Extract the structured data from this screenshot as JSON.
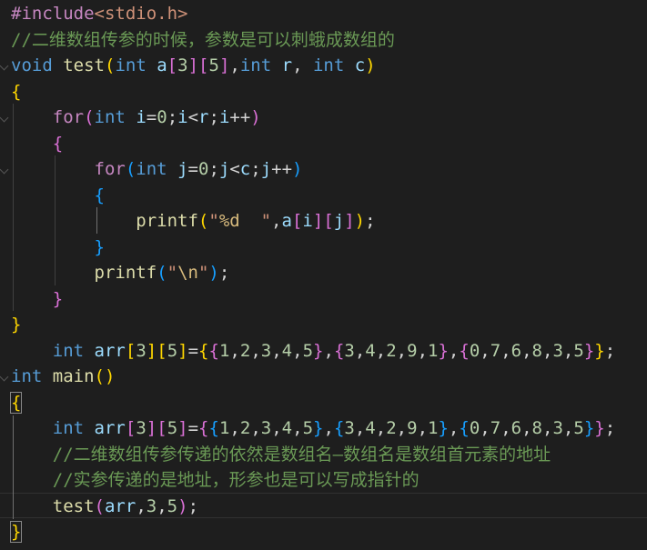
{
  "editor": {
    "lines": [
      [
        {
          "t": "#include",
          "c": "pp"
        },
        {
          "t": "<stdio.h>",
          "c": "inc"
        }
      ],
      [
        {
          "t": "//二维数组传参的时候，参数是可以刺蛾成数组的",
          "c": "cm"
        }
      ],
      [
        {
          "t": "void",
          "c": "kw"
        },
        {
          "t": " ",
          "c": "p"
        },
        {
          "t": "test",
          "c": "fn"
        },
        {
          "t": "(",
          "c": "b1"
        },
        {
          "t": "int",
          "c": "kw"
        },
        {
          "t": " ",
          "c": "p"
        },
        {
          "t": "a",
          "c": "var"
        },
        {
          "t": "[",
          "c": "b2"
        },
        {
          "t": "3",
          "c": "num"
        },
        {
          "t": "]",
          "c": "b2"
        },
        {
          "t": "[",
          "c": "b2"
        },
        {
          "t": "5",
          "c": "num"
        },
        {
          "t": "]",
          "c": "b2"
        },
        {
          "t": ",",
          "c": "p"
        },
        {
          "t": "int",
          "c": "kw"
        },
        {
          "t": " ",
          "c": "p"
        },
        {
          "t": "r",
          "c": "var"
        },
        {
          "t": ", ",
          "c": "p"
        },
        {
          "t": "int",
          "c": "kw"
        },
        {
          "t": " ",
          "c": "p"
        },
        {
          "t": "c",
          "c": "var"
        },
        {
          "t": ")",
          "c": "b1"
        }
      ],
      [
        {
          "t": "{",
          "c": "b1"
        }
      ],
      [
        {
          "t": "    ",
          "c": "p"
        },
        {
          "t": "for",
          "c": "ctl"
        },
        {
          "t": "(",
          "c": "b2"
        },
        {
          "t": "int",
          "c": "kw"
        },
        {
          "t": " ",
          "c": "p"
        },
        {
          "t": "i",
          "c": "var"
        },
        {
          "t": "=",
          "c": "p"
        },
        {
          "t": "0",
          "c": "num"
        },
        {
          "t": ";",
          "c": "p"
        },
        {
          "t": "i",
          "c": "var"
        },
        {
          "t": "<",
          "c": "p"
        },
        {
          "t": "r",
          "c": "var"
        },
        {
          "t": ";",
          "c": "p"
        },
        {
          "t": "i",
          "c": "var"
        },
        {
          "t": "++",
          "c": "p"
        },
        {
          "t": ")",
          "c": "b2"
        }
      ],
      [
        {
          "t": "    ",
          "c": "p"
        },
        {
          "t": "{",
          "c": "b2"
        }
      ],
      [
        {
          "t": "        ",
          "c": "p"
        },
        {
          "t": "for",
          "c": "ctl"
        },
        {
          "t": "(",
          "c": "b3"
        },
        {
          "t": "int",
          "c": "kw"
        },
        {
          "t": " ",
          "c": "p"
        },
        {
          "t": "j",
          "c": "var"
        },
        {
          "t": "=",
          "c": "p"
        },
        {
          "t": "0",
          "c": "num"
        },
        {
          "t": ";",
          "c": "p"
        },
        {
          "t": "j",
          "c": "var"
        },
        {
          "t": "<",
          "c": "p"
        },
        {
          "t": "c",
          "c": "var"
        },
        {
          "t": ";",
          "c": "p"
        },
        {
          "t": "j",
          "c": "var"
        },
        {
          "t": "++",
          "c": "p"
        },
        {
          "t": ")",
          "c": "b3"
        }
      ],
      [
        {
          "t": "        ",
          "c": "p"
        },
        {
          "t": "{",
          "c": "b3"
        }
      ],
      [
        {
          "t": "            ",
          "c": "p"
        },
        {
          "t": "printf",
          "c": "fn"
        },
        {
          "t": "(",
          "c": "b1"
        },
        {
          "t": "\"",
          "c": "str"
        },
        {
          "t": "%d",
          "c": "esc"
        },
        {
          "t": "  \"",
          "c": "str"
        },
        {
          "t": ",",
          "c": "p"
        },
        {
          "t": "a",
          "c": "var"
        },
        {
          "t": "[",
          "c": "b2"
        },
        {
          "t": "i",
          "c": "var"
        },
        {
          "t": "]",
          "c": "b2"
        },
        {
          "t": "[",
          "c": "b2"
        },
        {
          "t": "j",
          "c": "var"
        },
        {
          "t": "]",
          "c": "b2"
        },
        {
          "t": ")",
          "c": "b1"
        },
        {
          "t": ";",
          "c": "p"
        }
      ],
      [
        {
          "t": "        ",
          "c": "p"
        },
        {
          "t": "}",
          "c": "b3"
        }
      ],
      [
        {
          "t": "        ",
          "c": "p"
        },
        {
          "t": "printf",
          "c": "fn"
        },
        {
          "t": "(",
          "c": "b3"
        },
        {
          "t": "\"",
          "c": "str"
        },
        {
          "t": "\\n",
          "c": "esc"
        },
        {
          "t": "\"",
          "c": "str"
        },
        {
          "t": ")",
          "c": "b3"
        },
        {
          "t": ";",
          "c": "p"
        }
      ],
      [
        {
          "t": "    ",
          "c": "p"
        },
        {
          "t": "}",
          "c": "b2"
        }
      ],
      [
        {
          "t": "}",
          "c": "b1"
        }
      ],
      [
        {
          "t": "    ",
          "c": "p"
        },
        {
          "t": "int",
          "c": "kw"
        },
        {
          "t": " ",
          "c": "p"
        },
        {
          "t": "arr",
          "c": "var"
        },
        {
          "t": "[",
          "c": "b1"
        },
        {
          "t": "3",
          "c": "num"
        },
        {
          "t": "]",
          "c": "b1"
        },
        {
          "t": "[",
          "c": "b1"
        },
        {
          "t": "5",
          "c": "num"
        },
        {
          "t": "]",
          "c": "b1"
        },
        {
          "t": "=",
          "c": "p"
        },
        {
          "t": "{",
          "c": "b1"
        },
        {
          "t": "{",
          "c": "b2"
        },
        {
          "t": "1",
          "c": "num"
        },
        {
          "t": ",",
          "c": "p"
        },
        {
          "t": "2",
          "c": "num"
        },
        {
          "t": ",",
          "c": "p"
        },
        {
          "t": "3",
          "c": "num"
        },
        {
          "t": ",",
          "c": "p"
        },
        {
          "t": "4",
          "c": "num"
        },
        {
          "t": ",",
          "c": "p"
        },
        {
          "t": "5",
          "c": "num"
        },
        {
          "t": "}",
          "c": "b2"
        },
        {
          "t": ",",
          "c": "p"
        },
        {
          "t": "{",
          "c": "b2"
        },
        {
          "t": "3",
          "c": "num"
        },
        {
          "t": ",",
          "c": "p"
        },
        {
          "t": "4",
          "c": "num"
        },
        {
          "t": ",",
          "c": "p"
        },
        {
          "t": "2",
          "c": "num"
        },
        {
          "t": ",",
          "c": "p"
        },
        {
          "t": "9",
          "c": "num"
        },
        {
          "t": ",",
          "c": "p"
        },
        {
          "t": "1",
          "c": "num"
        },
        {
          "t": "}",
          "c": "b2"
        },
        {
          "t": ",",
          "c": "p"
        },
        {
          "t": "{",
          "c": "b2"
        },
        {
          "t": "0",
          "c": "num"
        },
        {
          "t": ",",
          "c": "p"
        },
        {
          "t": "7",
          "c": "num"
        },
        {
          "t": ",",
          "c": "p"
        },
        {
          "t": "6",
          "c": "num"
        },
        {
          "t": ",",
          "c": "p"
        },
        {
          "t": "8",
          "c": "num"
        },
        {
          "t": ",",
          "c": "p"
        },
        {
          "t": "3",
          "c": "num"
        },
        {
          "t": ",",
          "c": "p"
        },
        {
          "t": "5",
          "c": "num"
        },
        {
          "t": "}",
          "c": "b2"
        },
        {
          "t": "}",
          "c": "b1"
        },
        {
          "t": ";",
          "c": "p"
        }
      ],
      [
        {
          "t": "int",
          "c": "kw"
        },
        {
          "t": " ",
          "c": "p"
        },
        {
          "t": "main",
          "c": "fn"
        },
        {
          "t": "()",
          "c": "b1"
        }
      ],
      [
        {
          "t": "{",
          "c": "b1",
          "box": true
        }
      ],
      [
        {
          "t": "    ",
          "c": "p"
        },
        {
          "t": "int",
          "c": "kw"
        },
        {
          "t": " ",
          "c": "p"
        },
        {
          "t": "arr",
          "c": "var"
        },
        {
          "t": "[",
          "c": "b2"
        },
        {
          "t": "3",
          "c": "num"
        },
        {
          "t": "]",
          "c": "b2"
        },
        {
          "t": "[",
          "c": "b2"
        },
        {
          "t": "5",
          "c": "num"
        },
        {
          "t": "]",
          "c": "b2"
        },
        {
          "t": "=",
          "c": "p"
        },
        {
          "t": "{",
          "c": "b2"
        },
        {
          "t": "{",
          "c": "b3"
        },
        {
          "t": "1",
          "c": "num"
        },
        {
          "t": ",",
          "c": "p"
        },
        {
          "t": "2",
          "c": "num"
        },
        {
          "t": ",",
          "c": "p"
        },
        {
          "t": "3",
          "c": "num"
        },
        {
          "t": ",",
          "c": "p"
        },
        {
          "t": "4",
          "c": "num"
        },
        {
          "t": ",",
          "c": "p"
        },
        {
          "t": "5",
          "c": "num"
        },
        {
          "t": "}",
          "c": "b3"
        },
        {
          "t": ",",
          "c": "p"
        },
        {
          "t": "{",
          "c": "b3"
        },
        {
          "t": "3",
          "c": "num"
        },
        {
          "t": ",",
          "c": "p"
        },
        {
          "t": "4",
          "c": "num"
        },
        {
          "t": ",",
          "c": "p"
        },
        {
          "t": "2",
          "c": "num"
        },
        {
          "t": ",",
          "c": "p"
        },
        {
          "t": "9",
          "c": "num"
        },
        {
          "t": ",",
          "c": "p"
        },
        {
          "t": "1",
          "c": "num"
        },
        {
          "t": "}",
          "c": "b3"
        },
        {
          "t": ",",
          "c": "p"
        },
        {
          "t": "{",
          "c": "b3"
        },
        {
          "t": "0",
          "c": "num"
        },
        {
          "t": ",",
          "c": "p"
        },
        {
          "t": "7",
          "c": "num"
        },
        {
          "t": ",",
          "c": "p"
        },
        {
          "t": "6",
          "c": "num"
        },
        {
          "t": ",",
          "c": "p"
        },
        {
          "t": "8",
          "c": "num"
        },
        {
          "t": ",",
          "c": "p"
        },
        {
          "t": "3",
          "c": "num"
        },
        {
          "t": ",",
          "c": "p"
        },
        {
          "t": "5",
          "c": "num"
        },
        {
          "t": "}",
          "c": "b3"
        },
        {
          "t": "}",
          "c": "b2"
        },
        {
          "t": ";",
          "c": "p"
        }
      ],
      [
        {
          "t": "    ",
          "c": "p"
        },
        {
          "t": "//二维数组传参传递的依然是数组名—数组名是数组首元素的地址",
          "c": "cm"
        }
      ],
      [
        {
          "t": "    ",
          "c": "p"
        },
        {
          "t": "//实参传递的是地址，形参也是可以写成指针的",
          "c": "cm"
        }
      ],
      [
        {
          "t": "    ",
          "c": "p"
        },
        {
          "t": "test",
          "c": "fn"
        },
        {
          "t": "(",
          "c": "b2"
        },
        {
          "t": "arr",
          "c": "var"
        },
        {
          "t": ",",
          "c": "p"
        },
        {
          "t": "3",
          "c": "num"
        },
        {
          "t": ",",
          "c": "p"
        },
        {
          "t": "5",
          "c": "num"
        },
        {
          "t": ")",
          "c": "b2"
        },
        {
          "t": ";",
          "c": "p"
        }
      ],
      [
        {
          "t": "}",
          "c": "b1",
          "box": true
        }
      ]
    ]
  }
}
